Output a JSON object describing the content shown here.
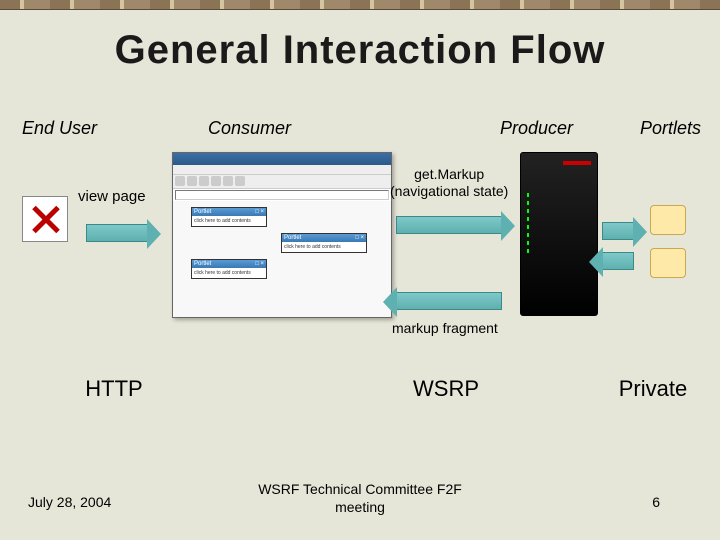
{
  "title": "General Interaction Flow",
  "columns": {
    "enduser": "End User",
    "consumer": "Consumer",
    "producer": "Producer",
    "portlets": "Portlets"
  },
  "labels": {
    "view_page": "view page",
    "get_markup_line1": "get.Markup",
    "get_markup_line2": "(navigational state)",
    "markup_fragment": "markup fragment"
  },
  "portlet_window": {
    "title": "Portlet",
    "body_hint": "click here to add contents"
  },
  "protocols": {
    "http": "HTTP",
    "wsrp": "WSRP",
    "private": "Private"
  },
  "footer": {
    "date": "July 28, 2004",
    "center_line1": "WSRF Technical Committee F2F",
    "center_line2": "meeting",
    "page_number": "6"
  }
}
